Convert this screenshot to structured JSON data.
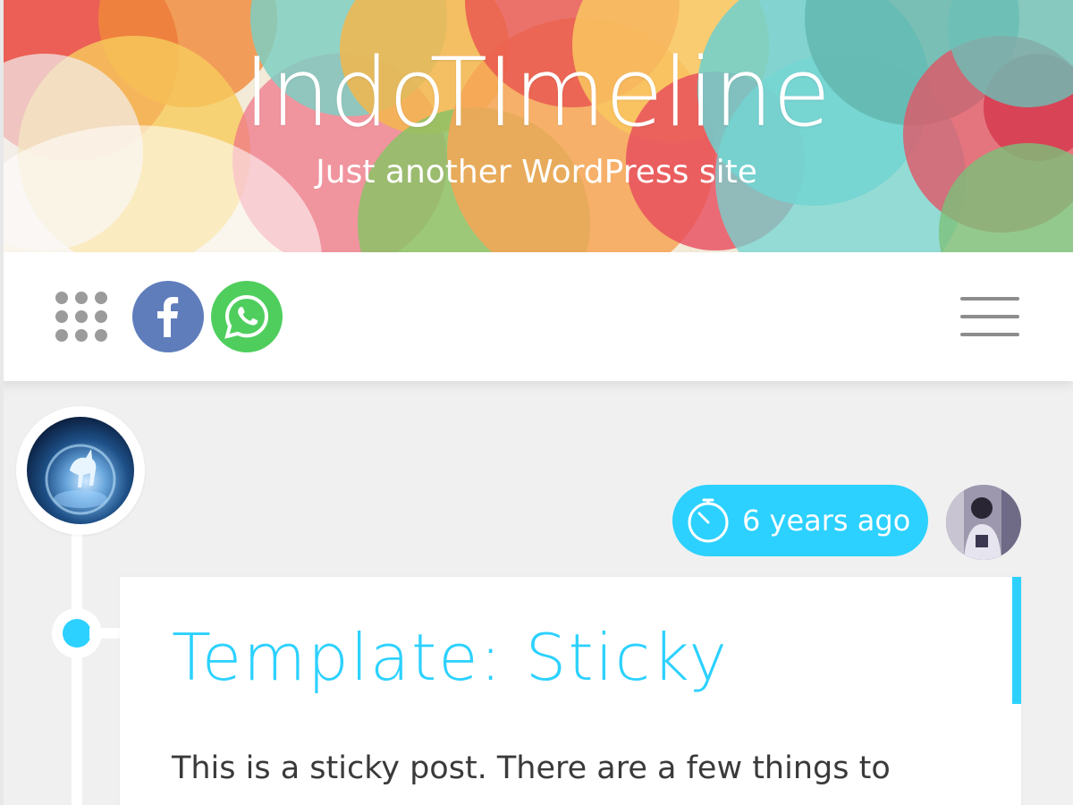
{
  "header": {
    "site_title": "IndoTImeline",
    "tagline": "Just another WordPress site"
  },
  "toolbar": {
    "apps_icon": "grid-dots-icon",
    "social": [
      {
        "name": "facebook",
        "icon": "facebook-icon",
        "color": "#5f7dbb"
      },
      {
        "name": "whatsapp",
        "icon": "whatsapp-icon",
        "color": "#4fce5d"
      }
    ],
    "menu_icon": "hamburger-icon"
  },
  "post": {
    "date": "6 years ago",
    "date_icon": "stopwatch-icon",
    "title": "Template: Sticky",
    "excerpt": "This is a sticky post. There are a few things to"
  },
  "colors": {
    "accent": "#2cd1ff",
    "background": "#f0f0f0",
    "icon_gray": "#9b9b9b"
  }
}
